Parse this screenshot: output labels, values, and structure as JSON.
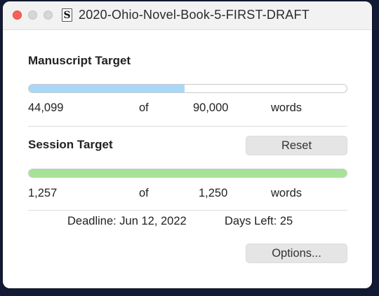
{
  "window": {
    "title": "2020-Ohio-Novel-Book-5-FIRST-DRAFT",
    "doc_icon_glyph": "S"
  },
  "manuscript": {
    "heading": "Manuscript Target",
    "current": "44,099",
    "of": "of",
    "target": "90,000",
    "unit": "words",
    "progress_fraction": 0.49,
    "bar_color": "#a8d8f8"
  },
  "session": {
    "heading": "Session Target",
    "reset_label": "Reset",
    "current": "1,257",
    "of": "of",
    "target": "1,250",
    "unit": "words",
    "progress_fraction": 1.0,
    "bar_color": "#a6e297"
  },
  "deadline": {
    "text": "Deadline: Jun 12, 2022",
    "days_left": "Days Left: 25"
  },
  "options_label": "Options..."
}
